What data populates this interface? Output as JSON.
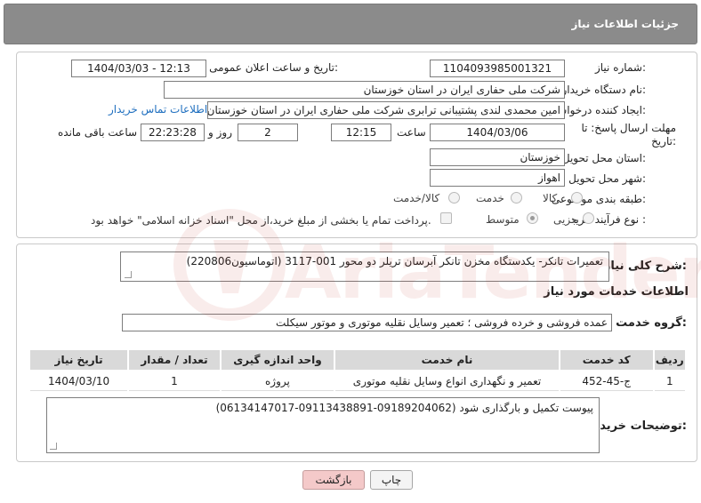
{
  "header": {
    "title": "جزئیات اطلاعات نیاز"
  },
  "fields": {
    "need_number_label": "شماره نیاز:",
    "need_number": "1104093985001321",
    "announce_label": "تاریخ و ساعت اعلان عمومی:",
    "announce_value": "1404/03/03 - 12:13",
    "buyer_org_label": "نام دستگاه خریدار:",
    "buyer_org": "شرکت ملی حفاری ایران در استان خوزستان",
    "creator_label": "ایجاد کننده درخواست:",
    "creator": "امین محمدی لندی پشتیبانی ترابری شرکت ملی حفاری ایران در استان خوزستان",
    "contact_link": "اطلاعات تماس خریدار",
    "deadline_label": "مهلت ارسال پاسخ: تا تاریخ:",
    "deadline_date": "1404/03/06",
    "time_label": "ساعت",
    "deadline_time": "12:15",
    "days_value": "2",
    "days_label": "روز و",
    "remaining_value": "22:23:28",
    "remaining_label": "ساعت باقی مانده",
    "province_label": "استان محل تحویل:",
    "province": "خوزستان",
    "city_label": "شهر محل تحویل:",
    "city": "اهواز",
    "category_label": "طبقه بندی موضوعی:",
    "category_options": [
      "کالا",
      "خدمت",
      "کالا/خدمت"
    ],
    "process_label": "نوع فرآیند خرید :",
    "process_options": [
      "جزیی",
      "متوسط"
    ],
    "payment_note": "پرداخت تمام یا بخشی از مبلغ خرید،از محل \"اسناد خزانه اسلامی\" خواهد بود."
  },
  "summary": {
    "label": "شرح کلی نیاز:",
    "text": "تعمیرات تانکر- یکدستگاه مخزن تانکر آبرسان تریلر دو محور 001-3117 (اتوماسیون220806)"
  },
  "services": {
    "section_title": "اطلاعات خدمات مورد نیاز",
    "group_label": "گروه خدمت:",
    "group_value": "عمده فروشی و خرده فروشی ؛ تعمیر وسایل نقلیه موتوری و موتور سیکلت",
    "columns": [
      "ردیف",
      "کد خدمت",
      "نام خدمت",
      "واحد اندازه گیری",
      "تعداد / مقدار",
      "تاریخ نیاز"
    ],
    "rows": [
      [
        "1",
        "ج-45-452",
        "تعمیر و نگهداری انواع وسایل نقلیه موتوری",
        "پروژه",
        "1",
        "1404/03/10"
      ]
    ]
  },
  "notes": {
    "label": "توضیحات خریدار:",
    "text": "پیوست تکمیل و بارگذاری شود (09189204062-09113438891-06134147017)"
  },
  "buttons": {
    "print": "چاپ",
    "back": "بازگشت"
  },
  "colors": {
    "header": "#8b8b8b",
    "link": "#1f6fbf",
    "back_button": "#f4c9c9"
  }
}
